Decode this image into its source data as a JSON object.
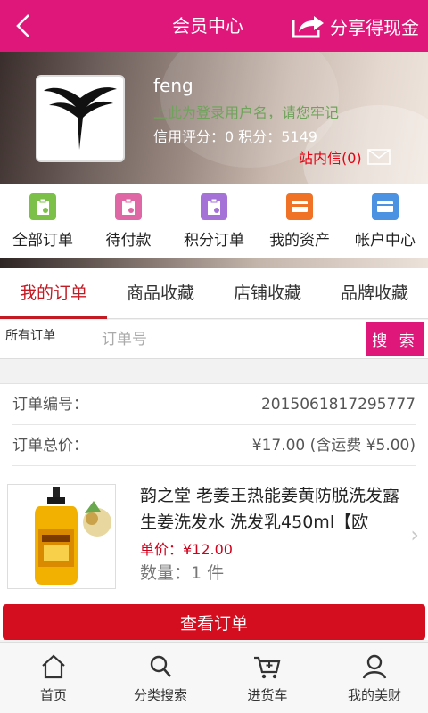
{
  "header": {
    "title": "会员中心",
    "share_label": "分享得现金"
  },
  "profile": {
    "username": "feng",
    "marquee_text": "上此为登录用户名，请您牢记",
    "stats_text": "信用评分：0 积分：5149",
    "messages_label": "站内信(0)"
  },
  "menu": {
    "items": [
      {
        "label": "全部订单",
        "icon": "all-orders-icon",
        "color": "#7cc04a"
      },
      {
        "label": "待付款",
        "icon": "pending-payment-icon",
        "color": "#e067a6"
      },
      {
        "label": "积分订单",
        "icon": "points-order-icon",
        "color": "#a572d8"
      },
      {
        "label": "我的资产",
        "icon": "assets-icon",
        "color": "#ef7226"
      },
      {
        "label": "帐户中心",
        "icon": "account-center-icon",
        "color": "#4c92e3"
      }
    ]
  },
  "tabs": [
    "我的订单",
    "商品收藏",
    "店铺收藏",
    "品牌收藏"
  ],
  "search": {
    "filter_label": "所有订单",
    "placeholder": "订单号",
    "button_label": "搜 索"
  },
  "order": {
    "number_label": "订单编号：",
    "number_value": "2015061817295777",
    "total_label": "订单总价：",
    "total_value": "¥17.00 (含运费 ¥5.00)",
    "product_name": "韵之堂 老姜王热能姜黄防脱洗发露 生姜洗发水 洗发乳450ml【欧",
    "price_text": "单价：¥12.00",
    "quantity_text": "数量：1 件",
    "view_button": "查看订单"
  },
  "bottom_nav": [
    {
      "label": "首页",
      "icon": "home-icon"
    },
    {
      "label": "分类搜索",
      "icon": "search-icon"
    },
    {
      "label": "进货车",
      "icon": "cart-icon"
    },
    {
      "label": "我的美财",
      "icon": "user-icon"
    }
  ],
  "colors": {
    "brand": "#e0177b",
    "accent_red": "#d40d1f"
  }
}
